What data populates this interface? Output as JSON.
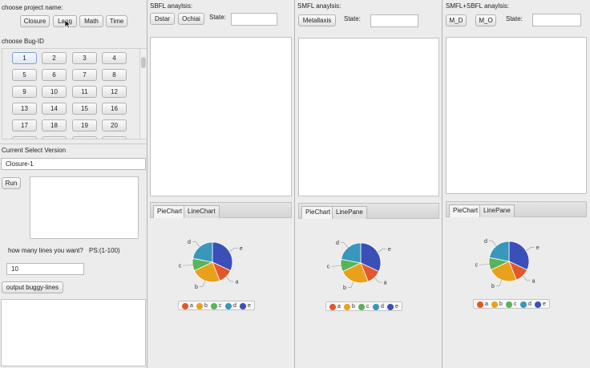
{
  "left": {
    "project_label": "choose project name:",
    "projects": [
      "Closure",
      "Lang",
      "Math",
      "Time"
    ],
    "bug_label": "choose Bug-ID",
    "bug_ids": [
      "1",
      "2",
      "3",
      "4",
      "5",
      "6",
      "7",
      "8",
      "9",
      "10",
      "11",
      "12",
      "13",
      "14",
      "15",
      "16",
      "17",
      "18",
      "19",
      "20"
    ],
    "current_label": "Current Select Version",
    "current_value": "Closure-1",
    "run_label": "Run",
    "lines_label": "how many lines you want?",
    "lines_hint": "PS:(1-100)",
    "lines_value": "10",
    "output_label": "output  buggy-lines"
  },
  "panels": [
    {
      "title": "SBFL anaylsis:",
      "buttons": [
        "Dstar",
        "Ochiai"
      ],
      "state_label": "State:",
      "state_value": "",
      "tabs": [
        "PieChart",
        "LineChart"
      ]
    },
    {
      "title": "SMFL anaylsis:",
      "buttons": [
        "Metallaxis"
      ],
      "state_label": "State:",
      "state_value": "",
      "tabs": [
        "PieChart",
        "LinePane"
      ]
    },
    {
      "title": "SMFL+SBFL anaylsis:",
      "buttons": [
        "M_D",
        "M_O"
      ],
      "state_label": "State:",
      "state_value": "",
      "tabs": [
        "PieChart",
        "LinePane"
      ]
    }
  ],
  "chart_data": [
    {
      "type": "pie",
      "categories": [
        "a",
        "b",
        "c",
        "d",
        "e"
      ],
      "values": [
        12,
        24,
        10,
        22,
        32
      ],
      "legend_position": "bottom",
      "colors": [
        "#e2582a",
        "#e9a11c",
        "#58b359",
        "#3897ba",
        "#3b4fb8"
      ]
    },
    {
      "type": "pie",
      "categories": [
        "a",
        "b",
        "c",
        "d",
        "e"
      ],
      "values": [
        12,
        24,
        10,
        22,
        32
      ],
      "legend_position": "bottom",
      "colors": [
        "#e2582a",
        "#e9a11c",
        "#58b359",
        "#3897ba",
        "#3b4fb8"
      ]
    },
    {
      "type": "pie",
      "categories": [
        "a",
        "b",
        "c",
        "d",
        "e"
      ],
      "values": [
        12,
        24,
        10,
        22,
        32
      ],
      "legend_position": "bottom",
      "colors": [
        "#e2582a",
        "#e9a11c",
        "#58b359",
        "#3897ba",
        "#3b4fb8"
      ]
    }
  ]
}
